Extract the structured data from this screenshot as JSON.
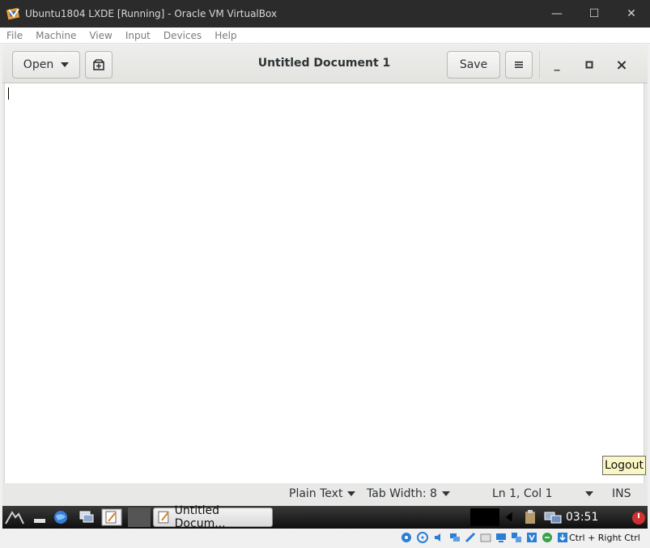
{
  "vbox": {
    "title": "Ubuntu1804 LXDE [Running] - Oracle VM VirtualBox",
    "controls": {
      "minimize": "—",
      "maximize": "☐",
      "close": "✕"
    },
    "menu": [
      "File",
      "Machine",
      "View",
      "Input",
      "Devices",
      "Help"
    ],
    "host_key": "Ctrl + Right Ctrl"
  },
  "gedit": {
    "open_label": "Open",
    "save_label": "Save",
    "document_title": "Untitled Document 1",
    "window_controls": {
      "minimize": "_",
      "maximize": "▫",
      "close": "×"
    },
    "status": {
      "language": "Plain Text",
      "tab_width": "Tab Width: 8",
      "position": "Ln 1, Col 1",
      "mode": "INS"
    }
  },
  "taskbar": {
    "task_label": "Untitled Docum...",
    "clock": "03:51",
    "tooltip": "Logout"
  },
  "colors": {
    "vbox_titlebar": "#2b2b2b",
    "header_bg": "#e6e6e3",
    "taskbar_bg": "#1a1a1a",
    "tooltip_bg": "#fbf7c4"
  }
}
